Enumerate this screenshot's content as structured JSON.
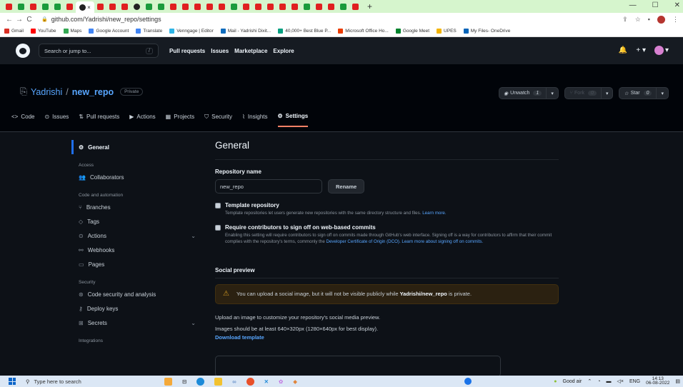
{
  "browser": {
    "url": "github.com/Yadrishi/new_repo/settings",
    "active_tab_close": "×",
    "new_tab": "+",
    "window_controls": {
      "minimize": "—",
      "maximize": "☐",
      "close": "✕"
    },
    "bookmarks": [
      {
        "label": "Gmail",
        "color": "#d93025"
      },
      {
        "label": "YouTube",
        "color": "#ff0000"
      },
      {
        "label": "Maps",
        "color": "#34a853"
      },
      {
        "label": "Google Account",
        "color": "#4285f4"
      },
      {
        "label": "Translate",
        "color": "#4285f4"
      },
      {
        "label": "Venngage | Editor",
        "color": "#2fb5e6"
      },
      {
        "label": "Mail - Yadrishi Dixit...",
        "color": "#0f6cbd"
      },
      {
        "label": "40,000+ Best Blue P...",
        "color": "#05a081"
      },
      {
        "label": "Microsoft Office Ho...",
        "color": "#eb3c00"
      },
      {
        "label": "Google Meet",
        "color": "#00832d"
      },
      {
        "label": "UPES",
        "color": "#f4b400"
      },
      {
        "label": "My Files- OneDrive",
        "color": "#0364b8"
      }
    ]
  },
  "header": {
    "search_placeholder": "Search or jump to...",
    "search_key": "/",
    "nav": [
      "Pull requests",
      "Issues",
      "Marketplace",
      "Explore"
    ],
    "bell": "🔔",
    "plus": "+ ▾",
    "avatar_caret": "▾"
  },
  "repo": {
    "owner": "Yadrishi",
    "separator": " / ",
    "name": "new_repo",
    "visibility": "Private",
    "unwatch": {
      "label": "Unwatch",
      "count": "1"
    },
    "fork": {
      "label": "Fork",
      "count": "0"
    },
    "star": {
      "label": "Star",
      "count": "0"
    },
    "tabs": [
      {
        "label": "Code",
        "icon": "<>"
      },
      {
        "label": "Issues",
        "icon": "⊙"
      },
      {
        "label": "Pull requests",
        "icon": "⇅"
      },
      {
        "label": "Actions",
        "icon": "▶"
      },
      {
        "label": "Projects",
        "icon": "▦"
      },
      {
        "label": "Security",
        "icon": "⛉"
      },
      {
        "label": "Insights",
        "icon": "⌇"
      },
      {
        "label": "Settings",
        "icon": "⚙"
      }
    ]
  },
  "sidebar": {
    "general": "General",
    "groups": [
      {
        "title": "Access",
        "items": [
          {
            "label": "Collaborators",
            "icon": "👥"
          }
        ]
      },
      {
        "title": "Code and automation",
        "items": [
          {
            "label": "Branches",
            "icon": "⑂"
          },
          {
            "label": "Tags",
            "icon": "◇"
          },
          {
            "label": "Actions",
            "icon": "⊙",
            "caret": "⌄"
          },
          {
            "label": "Webhooks",
            "icon": "⚯"
          },
          {
            "label": "Pages",
            "icon": "▭"
          }
        ]
      },
      {
        "title": "Security",
        "items": [
          {
            "label": "Code security and analysis",
            "icon": "⊛"
          },
          {
            "label": "Deploy keys",
            "icon": "⚷"
          },
          {
            "label": "Secrets",
            "icon": "⊞",
            "caret": "⌄"
          }
        ]
      },
      {
        "title": "Integrations",
        "items": []
      }
    ]
  },
  "main": {
    "title": "General",
    "repo_name_label": "Repository name",
    "repo_name_value": "new_repo",
    "rename": "Rename",
    "template_title": "Template repository",
    "template_desc": "Template repositories let users generate new repositories with the same directory structure and files.",
    "template_link": "Learn more.",
    "signoff_title": "Require contributors to sign off on web-based commits",
    "signoff_desc": "Enabling this setting will require contributors to sign off on commits made through GitHub's web interface. Signing off is a way for contributors to affirm that their commit complies with the repository's terms, commonly the",
    "signoff_link": "Developer Certificate of Origin (DCO). Learn more about signing off on commits.",
    "social_title": "Social preview",
    "warning_pre": "You can upload a social image, but it will not be visible publicly while ",
    "warning_repo": "Yadrishi/new_repo",
    "warning_post": " is private.",
    "upload_text": "Upload an image to customize your repository's social media preview.",
    "size_text": "Images should be at least 640×320px (1280×640px for best display).",
    "download": "Download template"
  },
  "taskbar": {
    "search": "Type here to search",
    "weather": "Good air",
    "lang": "ENG",
    "time": "14:13",
    "date": "06-08-2022"
  }
}
